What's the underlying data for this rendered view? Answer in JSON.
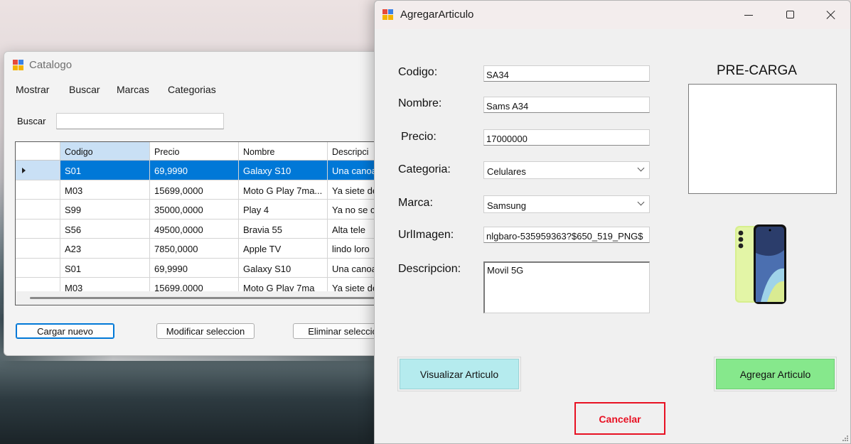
{
  "catalogo": {
    "title": "Catalogo",
    "menu": [
      "Mostrar",
      "Buscar",
      "Marcas",
      "Categorias"
    ],
    "search": {
      "label": "Buscar",
      "value": ""
    },
    "grid": {
      "columns": [
        "Codigo",
        "Precio",
        "Nombre",
        "Descripci"
      ],
      "rows": [
        {
          "codigo": "S01",
          "precio": "69,9990",
          "nombre": "Galaxy S10",
          "descripcion": "Una canoa",
          "selected": true
        },
        {
          "codigo": "M03",
          "precio": "15699,0000",
          "nombre": "Moto G Play 7ma...",
          "descripcion": "Ya siete de"
        },
        {
          "codigo": "S99",
          "precio": "35000,0000",
          "nombre": "Play 4",
          "descripcion": "Ya no se c"
        },
        {
          "codigo": "S56",
          "precio": "49500,0000",
          "nombre": "Bravia 55",
          "descripcion": "Alta tele"
        },
        {
          "codigo": "A23",
          "precio": "7850,0000",
          "nombre": "Apple TV",
          "descripcion": "lindo loro"
        },
        {
          "codigo": "S01",
          "precio": "69,9990",
          "nombre": "Galaxy S10",
          "descripcion": "Una canoa"
        },
        {
          "codigo": "M03",
          "precio": "15699,0000",
          "nombre": "Moto G Play 7ma",
          "descripcion": "Ya siete de"
        }
      ]
    },
    "buttons": {
      "cargar": "Cargar nuevo",
      "modificar": "Modificar seleccion",
      "eliminar": "Eliminar selecció"
    }
  },
  "agregar": {
    "title": "AgregarArticulo",
    "labels": {
      "codigo": "Codigo:",
      "nombre": "Nombre:",
      "precio": "Precio:",
      "categoria": "Categoria:",
      "marca": "Marca:",
      "url": "UrlImagen:",
      "descripcion": "Descripcion:"
    },
    "values": {
      "codigo": "SA34",
      "nombre": "Sams A34",
      "precio": "17000000",
      "categoria": "Celulares",
      "marca": "Samsung",
      "url": "nlgbaro-535959363?$650_519_PNG$",
      "descripcion": "Movil 5G"
    },
    "precarga_label": "PRE-CARGA",
    "buttons": {
      "visualizar": "Visualizar Articulo",
      "agregar": "Agregar Articulo",
      "cancelar": "Cancelar"
    }
  },
  "colors": {
    "selection": "#0078d7",
    "visualizar_bg": "#b5ebee",
    "agregar_bg": "#86e88c",
    "cancelar": "#e81123"
  }
}
